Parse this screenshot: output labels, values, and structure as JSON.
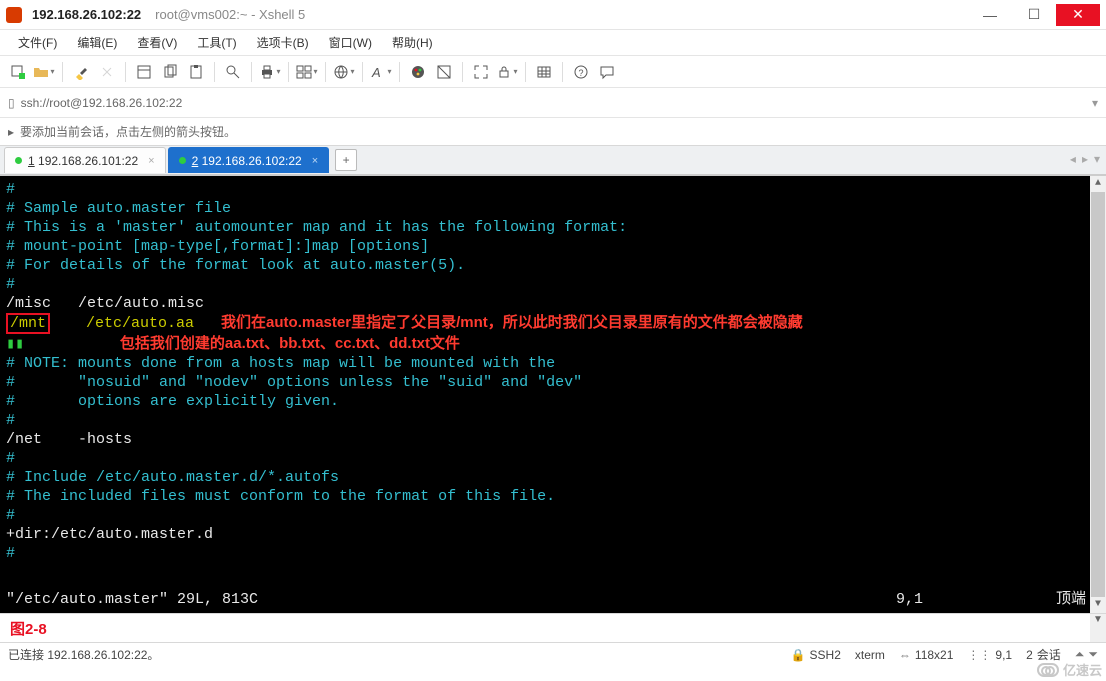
{
  "window": {
    "title_main": "192.168.26.102:22",
    "title_sub": "root@vms002:~ - Xshell 5"
  },
  "menu": {
    "file": "文件(F)",
    "edit": "编辑(E)",
    "view": "查看(V)",
    "tools": "工具(T)",
    "tabs": "选项卡(B)",
    "window": "窗口(W)",
    "help": "帮助(H)"
  },
  "url": {
    "value": "ssh://root@192.168.26.102:22"
  },
  "hint": {
    "text": "要添加当前会话，点击左侧的箭头按钮。"
  },
  "tabs": [
    {
      "number": "1",
      "label": "192.168.26.101:22",
      "active": false
    },
    {
      "number": "2",
      "label": "192.168.26.102:22",
      "active": true
    }
  ],
  "terminal": {
    "lines": [
      {
        "cls": "c-cyan",
        "text": "#"
      },
      {
        "cls": "c-cyan",
        "text": "# Sample auto.master file"
      },
      {
        "cls": "c-cyan",
        "text": "# This is a 'master' automounter map and it has the following format:"
      },
      {
        "cls": "c-cyan",
        "text": "# mount-point [map-type[,format]:]map [options]"
      },
      {
        "cls": "c-cyan",
        "text": "# For details of the format look at auto.master(5)."
      },
      {
        "cls": "c-cyan",
        "text": "#"
      },
      {
        "cls": "c-white",
        "text": "/misc   /etc/auto.misc"
      },
      {
        "segments": [
          {
            "cls": "boxed c-yellow",
            "text": "/mnt"
          },
          {
            "cls": "c-yellow",
            "text": "    /etc/auto.aa   "
          },
          {
            "cls": "c-red",
            "text": "我们在auto.master里指定了父目录/mnt，所以此时我们父目录里原有的文件都会被隐藏"
          }
        ]
      },
      {
        "segments": [
          {
            "cls": "c-green",
            "text": "▮▮"
          },
          {
            "cls": "c-red",
            "text": "                       包括我们创建的aa.txt、bb.txt、cc.txt、dd.txt文件"
          }
        ]
      },
      {
        "cls": "c-cyan",
        "text": "# NOTE: mounts done from a hosts map will be mounted with the"
      },
      {
        "cls": "c-cyan",
        "text": "#       \"nosuid\" and \"nodev\" options unless the \"suid\" and \"dev\""
      },
      {
        "cls": "c-cyan",
        "text": "#       options are explicitly given."
      },
      {
        "cls": "c-cyan",
        "text": "#"
      },
      {
        "cls": "c-white",
        "text": "/net    -hosts"
      },
      {
        "cls": "c-cyan",
        "text": "#"
      },
      {
        "cls": "c-cyan",
        "text": "# Include /etc/auto.master.d/*.autofs"
      },
      {
        "cls": "c-cyan",
        "text": "# The included files must conform to the format of this file."
      },
      {
        "cls": "c-cyan",
        "text": "#"
      },
      {
        "cls": "c-white",
        "text": "+dir:/etc/auto.master.d"
      },
      {
        "cls": "c-cyan",
        "text": "#"
      }
    ],
    "status": {
      "filename": "\"/etc/auto.master\" 29L, 813C",
      "position": "9,1",
      "scroll": "顶端"
    }
  },
  "figure": {
    "label": "图2-8"
  },
  "statusbar": {
    "connection": "已连接 192.168.26.102:22。",
    "protocol": "SSH2",
    "term": "xterm",
    "size": "118x21",
    "cursor": "9,1",
    "sessions_label": "会话",
    "sessions_count": "2"
  },
  "watermark": {
    "text": "亿速云"
  }
}
